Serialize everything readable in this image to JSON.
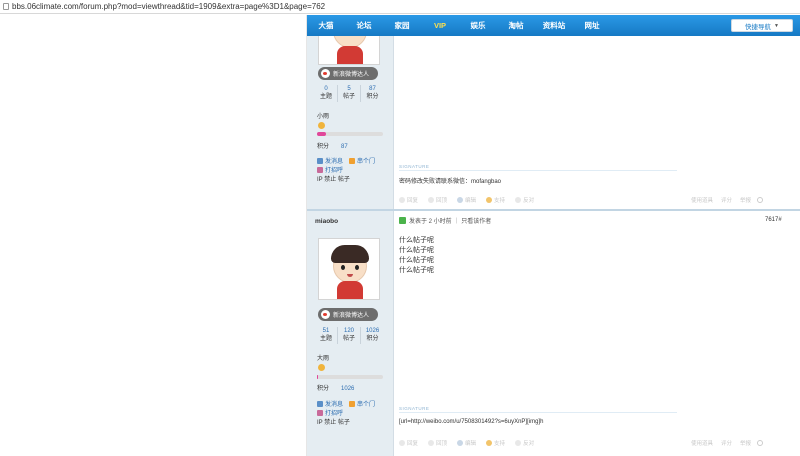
{
  "browser": {
    "url": "bbs.06climate.com/forum.php?mod=viewthread&tid=1909&extra=page%3D1&page=762"
  },
  "topnav": {
    "items": [
      "大猫",
      "论坛",
      "家园",
      "VIP",
      "娱乐",
      "淘帖",
      "资料站",
      "网址"
    ],
    "quick_nav": "快捷导航"
  },
  "posts": [
    {
      "weibo_label": "新浪微博达人",
      "stats": [
        {
          "value": "0",
          "label": "主题"
        },
        {
          "value": "5",
          "label": "帖子"
        },
        {
          "value": "87",
          "label": "积分"
        }
      ],
      "rank": "小雨",
      "points_label": "积分",
      "points_value": "87",
      "points_fraction": 0.13,
      "actions": {
        "message": "发消息",
        "visit": "串个门",
        "greet": "打招呼",
        "ip_ban": "IP 禁止",
        "post": "帖子"
      },
      "signature_heading": "SIGNATURE",
      "signature": "密码修改失败请联系微信：mofangbao",
      "post_actions": [
        "回复",
        "回顶",
        "编辑",
        "支持",
        "反对"
      ],
      "right_actions": [
        "使用道具",
        "评分",
        "举报"
      ]
    },
    {
      "username": "miaobo",
      "weibo_label": "新浪微博达人",
      "stats": [
        {
          "value": "51",
          "label": "主题"
        },
        {
          "value": "120",
          "label": "帖子"
        },
        {
          "value": "1026",
          "label": "积分"
        }
      ],
      "rank": "大雨",
      "points_label": "积分",
      "points_value": "1026",
      "points_fraction": 0.02,
      "actions": {
        "message": "发消息",
        "visit": "串个门",
        "greet": "打招呼",
        "ip_ban": "IP 禁止",
        "post": "帖子"
      },
      "meta_posted": "发表于 2 小时前",
      "meta_only_author": "只看该作者",
      "floor": "7617#",
      "content_lines": [
        "什么帖子呢",
        "什么帖子呢",
        "什么帖子呢",
        "什么帖子呢"
      ],
      "signature_heading": "SIGNATURE",
      "signature": "[url=http://weibo.com/u/7508301492?s=6uyXnP][img]h",
      "post_actions": [
        "回复",
        "回顶",
        "编辑",
        "支持",
        "反对"
      ],
      "right_actions": [
        "使用道具",
        "评分",
        "举报"
      ]
    }
  ],
  "colors": {
    "nav_blue": "#1b8ad9",
    "sidebar_bg": "#e5edf2",
    "link_blue": "#2b6cb0",
    "vip_yellow": "#ffe14d",
    "bar_pink": "#e0479a"
  }
}
